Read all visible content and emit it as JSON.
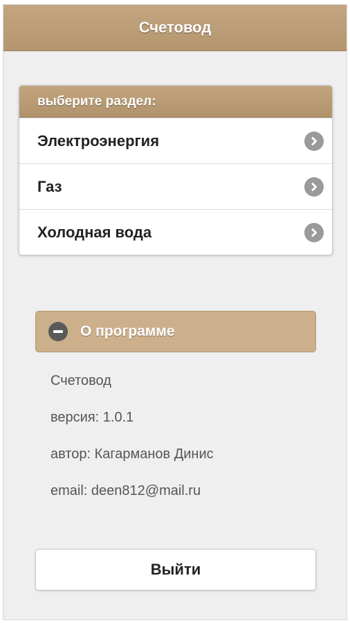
{
  "header": {
    "title": "Счетовод"
  },
  "menu": {
    "divider_label": "выберите раздел:",
    "items": [
      {
        "label": "Электроэнергия",
        "icon": "chevron-right-icon"
      },
      {
        "label": "Газ",
        "icon": "chevron-right-icon"
      },
      {
        "label": "Холодная вода",
        "icon": "chevron-right-icon"
      }
    ]
  },
  "about": {
    "title": "О программе",
    "icon": "minus-icon",
    "lines": [
      "Счетовод",
      "версия: 1.0.1",
      "автор: Кагарманов Динис",
      "email: deen812@mail.ru"
    ]
  },
  "exit_button": {
    "label": "Выйти"
  },
  "colors": {
    "header_bg": "#b9996f",
    "collapsible_bg": "#cbb08b",
    "background": "#efefef",
    "icon_gray": "#9a9a9a"
  }
}
